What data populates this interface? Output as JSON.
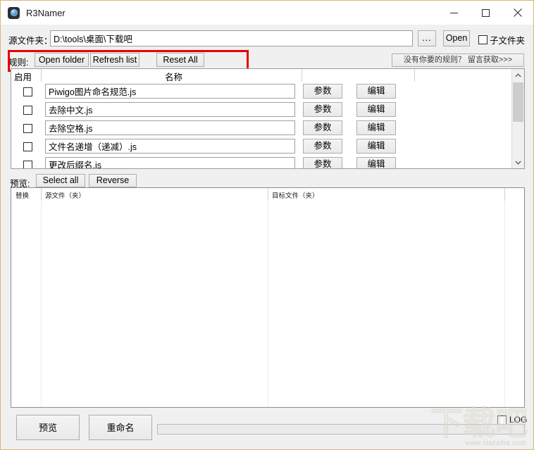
{
  "window": {
    "title": "R3Namer",
    "icon": "app-disc-icon",
    "minimize": "—",
    "maximize": "□",
    "close": "✕"
  },
  "source_row": {
    "label": "源文件夹：",
    "path_value": "D:\\tools\\桌面\\下载吧",
    "path_placeholder": "",
    "browse_label": "...",
    "open_label": "Open",
    "subfolder_label": "子文件夹",
    "subfolder_checked": false
  },
  "rules_toolbar": {
    "label": "规则:",
    "open_folder_label": "Open folder",
    "refresh_list_label": "Refresh list",
    "reset_all_label": "Reset All",
    "get_rules_label": "没有你要的规则？ 留言获取>>>"
  },
  "annotation": {
    "color": "#e60000"
  },
  "rules_list": {
    "headers": {
      "enable": "启用",
      "name": "名称"
    },
    "param_label": "参数",
    "edit_label": "编辑",
    "rows": [
      {
        "checked": false,
        "name": "Piwigo图片命名规范.js"
      },
      {
        "checked": false,
        "name": "去除中文.js"
      },
      {
        "checked": false,
        "name": "去除空格.js"
      },
      {
        "checked": false,
        "name": "文件名递增（递减）.js"
      },
      {
        "checked": false,
        "name": "更改后缀名.js"
      }
    ]
  },
  "preview_toolbar": {
    "label": "预览:",
    "select_all_label": "Select all",
    "reverse_label": "Reverse"
  },
  "preview_list": {
    "headers": {
      "replace": "替换",
      "source": "源文件（夹）",
      "target": "目标文件（夹）"
    },
    "rows": []
  },
  "bottom_bar": {
    "preview_label": "预览",
    "rename_label": "重命名",
    "log_label": "LOG",
    "log_checked": false,
    "progress_percent": 0
  },
  "watermark": {
    "logo_text": "下载吧",
    "url_text": "www.xiazaiba.com"
  }
}
